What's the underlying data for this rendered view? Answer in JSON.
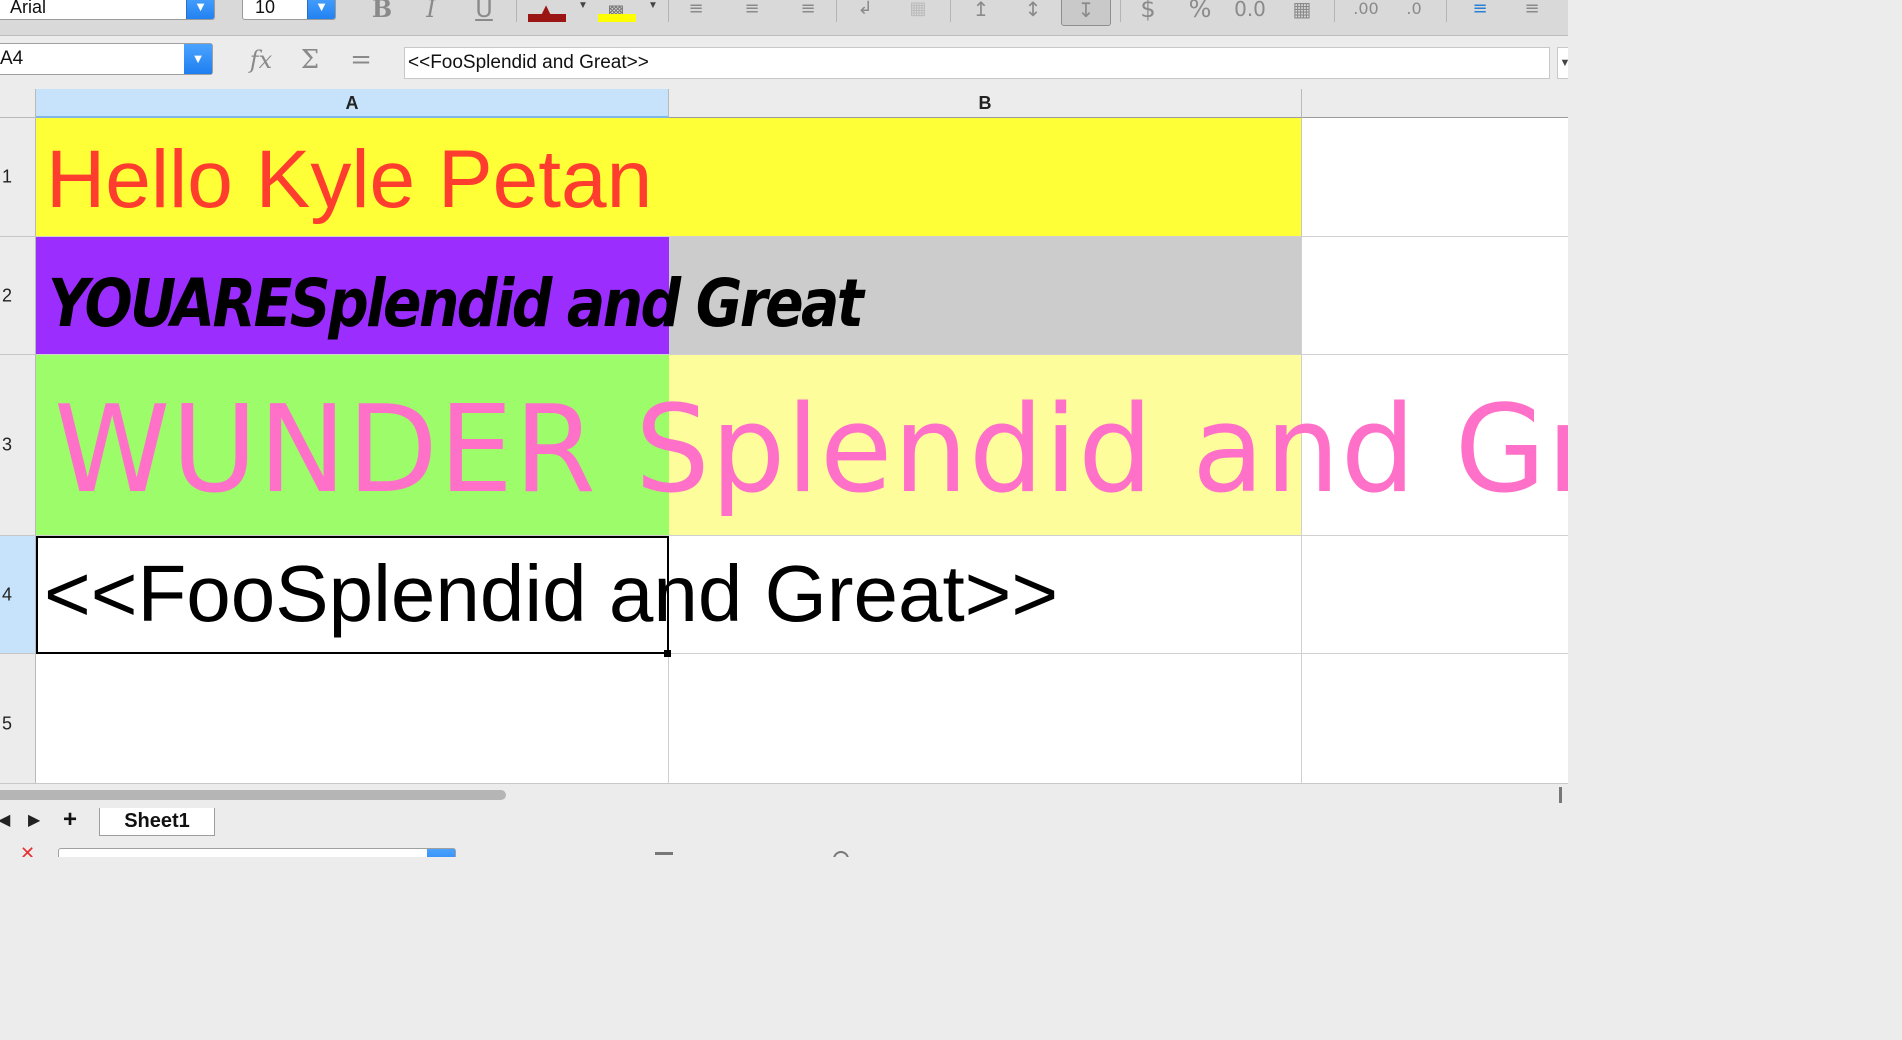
{
  "toolbar": {
    "font_name": "Arial",
    "font_size": "10",
    "bold_label": "B",
    "italic_label": "I",
    "underline_label": "U",
    "currency_label": "$",
    "percent_label": "%",
    "number_label": "0.0",
    "font_color": "#9b1515",
    "highlight_color": "#ffff00"
  },
  "formula_bar": {
    "cell_ref": "A4",
    "fx_symbol": "fx",
    "sum_symbol": "Σ",
    "equals_symbol": "=",
    "content": "<<FooSplendid and Great>>"
  },
  "columns": [
    "A",
    "B"
  ],
  "rows": [
    "1",
    "2",
    "3",
    "4",
    "5"
  ],
  "cells": {
    "A1": {
      "text": "Hello Kyle Petan",
      "color": "#ff3d2e",
      "fill": "#ffff38"
    },
    "A2": {
      "text": "YOUARESplendid and Great",
      "color": "#000000",
      "fill": "#9b2dff"
    },
    "B2": {
      "fill": "#cccccc"
    },
    "A3": {
      "text": "WUNDER Splendid and Gre",
      "color": "#ff70c8",
      "fill": "#9cfc6a"
    },
    "B3": {
      "fill": "#fdfd9b"
    },
    "A4": {
      "text": "<<FooSplendid and Great>>",
      "color": "#000000",
      "fill": "#ffffff"
    }
  },
  "sheet_tabs": [
    {
      "label": "Sheet1",
      "active": true
    }
  ],
  "icons": {
    "nav_prev": "triangle-left-icon",
    "nav_next": "triangle-right-icon",
    "add_sheet": "plus-icon"
  }
}
